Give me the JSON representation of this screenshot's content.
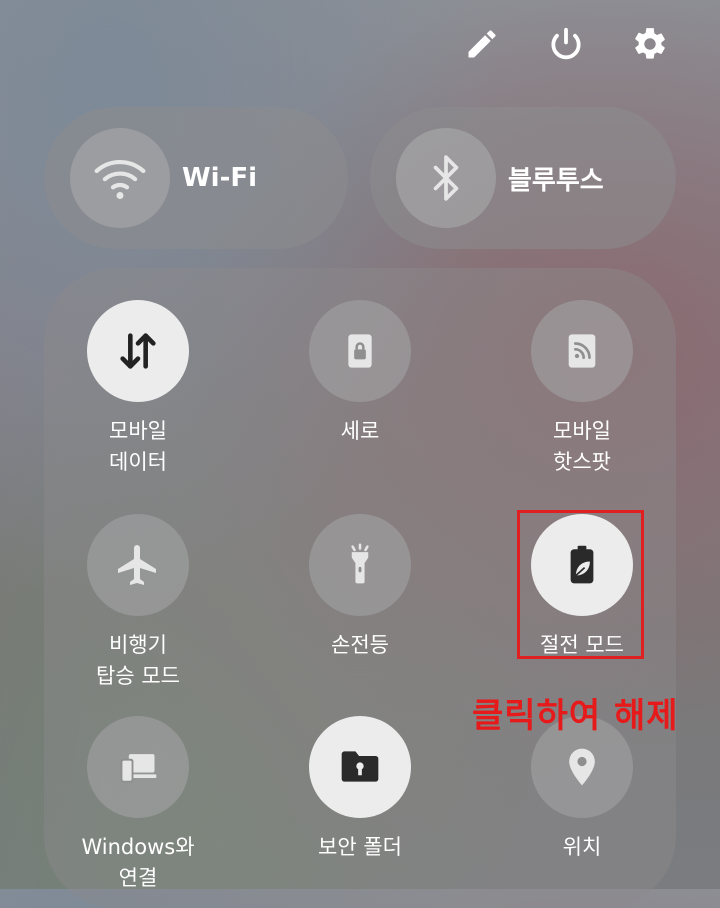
{
  "header": {
    "icons": [
      "edit-icon",
      "power-icon",
      "settings-icon"
    ]
  },
  "big_tiles": [
    {
      "label": "Wi-Fi",
      "icon": "wifi-icon"
    },
    {
      "label": "블루투스",
      "icon": "bluetooth-icon"
    }
  ],
  "tiles": [
    {
      "label": "모바일\n데이터",
      "icon": "mobile-data-icon",
      "active": true
    },
    {
      "label": "세로",
      "icon": "portrait-lock-icon",
      "active": false
    },
    {
      "label": "모바일\n핫스팟",
      "icon": "hotspot-icon",
      "active": false
    },
    {
      "label": "비행기\n탑승 모드",
      "icon": "airplane-icon",
      "active": false
    },
    {
      "label": "손전등",
      "icon": "flashlight-icon",
      "active": false
    },
    {
      "label": "절전 모드",
      "icon": "power-saving-icon",
      "active": true
    },
    {
      "label": "Windows와\n연결",
      "icon": "link-to-windows-icon",
      "active": false
    },
    {
      "label": "보안 폴더",
      "icon": "secure-folder-icon",
      "active": true
    },
    {
      "label": "위치",
      "icon": "location-icon",
      "active": false
    }
  ],
  "annotation": {
    "callout": "클릭하여 해제",
    "color": "#e02020"
  }
}
